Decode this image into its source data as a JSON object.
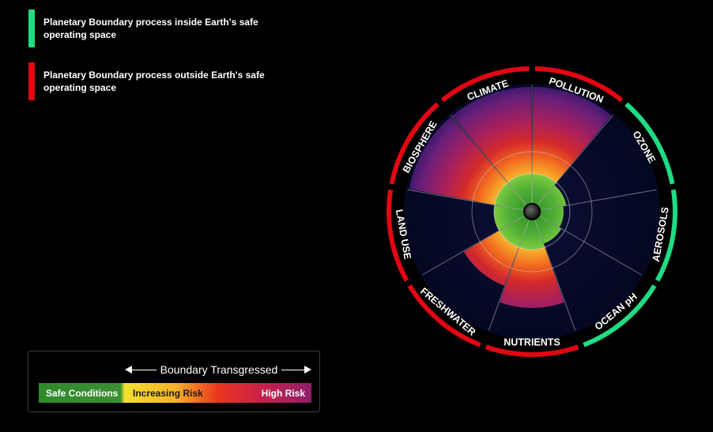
{
  "legend": [
    {
      "color": "#1fdc83",
      "text": "Planetary Boundary process inside Earth's safe operating space"
    },
    {
      "color": "#e30613",
      "text": "Planetary Boundary process outside Earth's safe operating space"
    }
  ],
  "scale": {
    "arrow_label": "Boundary Transgressed",
    "safe": "Safe Conditions",
    "increasing": "Increasing Risk",
    "high": "High Risk"
  },
  "boundaries": [
    {
      "label": "CLIMATE",
      "status": "outside"
    },
    {
      "label": "POLLUTION",
      "status": "outside"
    },
    {
      "label": "OZONE",
      "status": "inside"
    },
    {
      "label": "AEROSOLS",
      "status": "inside"
    },
    {
      "label": "OCEAN pH",
      "status": "inside"
    },
    {
      "label": "NUTRIENTS",
      "status": "outside"
    },
    {
      "label": "FRESHWATER",
      "status": "outside"
    },
    {
      "label": "LAND USE",
      "status": "outside"
    },
    {
      "label": "BIOSPHERE",
      "status": "outside"
    }
  ],
  "colors": {
    "safe": "#1fdc83",
    "unsafe": "#e30613",
    "background": "#000000",
    "disk": "#070b2e"
  }
}
